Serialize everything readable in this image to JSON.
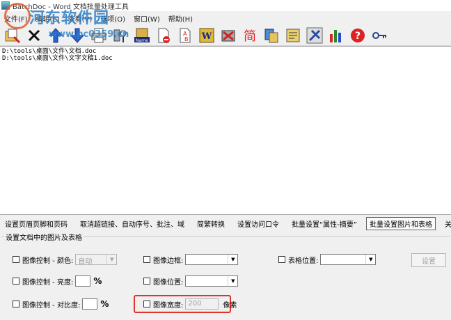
{
  "window": {
    "title": "BatchDoc - Word 文档批量处理工具"
  },
  "watermark": {
    "logo_text": "河东软件园",
    "url_text": "www.pc0359.cn"
  },
  "menu": {
    "items": [
      "文件(F)",
      "编辑(E)",
      "查看(V)",
      "选项(O)",
      "窗口(W)",
      "帮助(H)"
    ]
  },
  "toolbar": {
    "buttons": [
      {
        "name": "add-files",
        "icon": "add-files-icon"
      },
      {
        "name": "delete",
        "icon": "delete-x-icon"
      },
      {
        "name": "move-up",
        "icon": "arrow-up-icon"
      },
      {
        "name": "move-down",
        "icon": "arrow-down-icon"
      },
      {
        "name": "print",
        "icon": "printer-icon"
      },
      {
        "name": "batch-tools",
        "icon": "tools-icon"
      },
      {
        "name": "rename",
        "icon": "name-icon"
      },
      {
        "name": "delete-doc",
        "icon": "document-delete-icon"
      },
      {
        "name": "replace",
        "icon": "replace-ab-icon"
      },
      {
        "name": "word-icon",
        "icon": "word-icon"
      },
      {
        "name": "format",
        "icon": "format-icon"
      },
      {
        "name": "simplified",
        "icon": "simplified-chinese-icon"
      },
      {
        "name": "convert",
        "icon": "convert-icon"
      },
      {
        "name": "template",
        "icon": "template-icon"
      },
      {
        "name": "settings",
        "icon": "settings-icon"
      },
      {
        "name": "chart",
        "icon": "chart-icon"
      },
      {
        "name": "help",
        "icon": "help-icon"
      },
      {
        "name": "register",
        "icon": "key-icon"
      }
    ],
    "simplified_char": "简",
    "name_label": "Name"
  },
  "files": [
    "D:\\tools\\桌面\\文件\\文档.doc",
    "D:\\tools\\桌面\\文件\\文字文稿1.doc"
  ],
  "tabs": [
    {
      "label": "设置页眉页脚和页码",
      "active": false
    },
    {
      "label": "取消超链接、自动序号、批注、域",
      "active": false
    },
    {
      "label": "简繁转换",
      "active": false
    },
    {
      "label": "设置访问口令",
      "active": false
    },
    {
      "label": "批量设置“属性-摘要”",
      "active": false
    },
    {
      "label": "批量设置图片和表格",
      "active": true
    },
    {
      "label": "关于B",
      "active": false
    }
  ],
  "group": {
    "label": "设置文档中的图片及表格"
  },
  "options": {
    "image_color": {
      "label": "图像控制 - 颜色:",
      "value": "自动"
    },
    "image_brightness": {
      "label": "图像控制 - 亮度:",
      "value": "",
      "unit": "%"
    },
    "image_contrast": {
      "label": "图像控制 - 对比度:",
      "value": "",
      "unit": "%"
    },
    "image_border": {
      "label": "图像边框:",
      "value": ""
    },
    "image_position": {
      "label": "图像位置:",
      "value": ""
    },
    "image_width": {
      "label": "图像宽度:",
      "value": "200",
      "unit": "像素"
    },
    "table_position": {
      "label": "表格位置:",
      "value": ""
    },
    "set_button": "设置"
  },
  "colors": {
    "highlight": "#e0332b",
    "watermark": "#2a7fc8"
  }
}
